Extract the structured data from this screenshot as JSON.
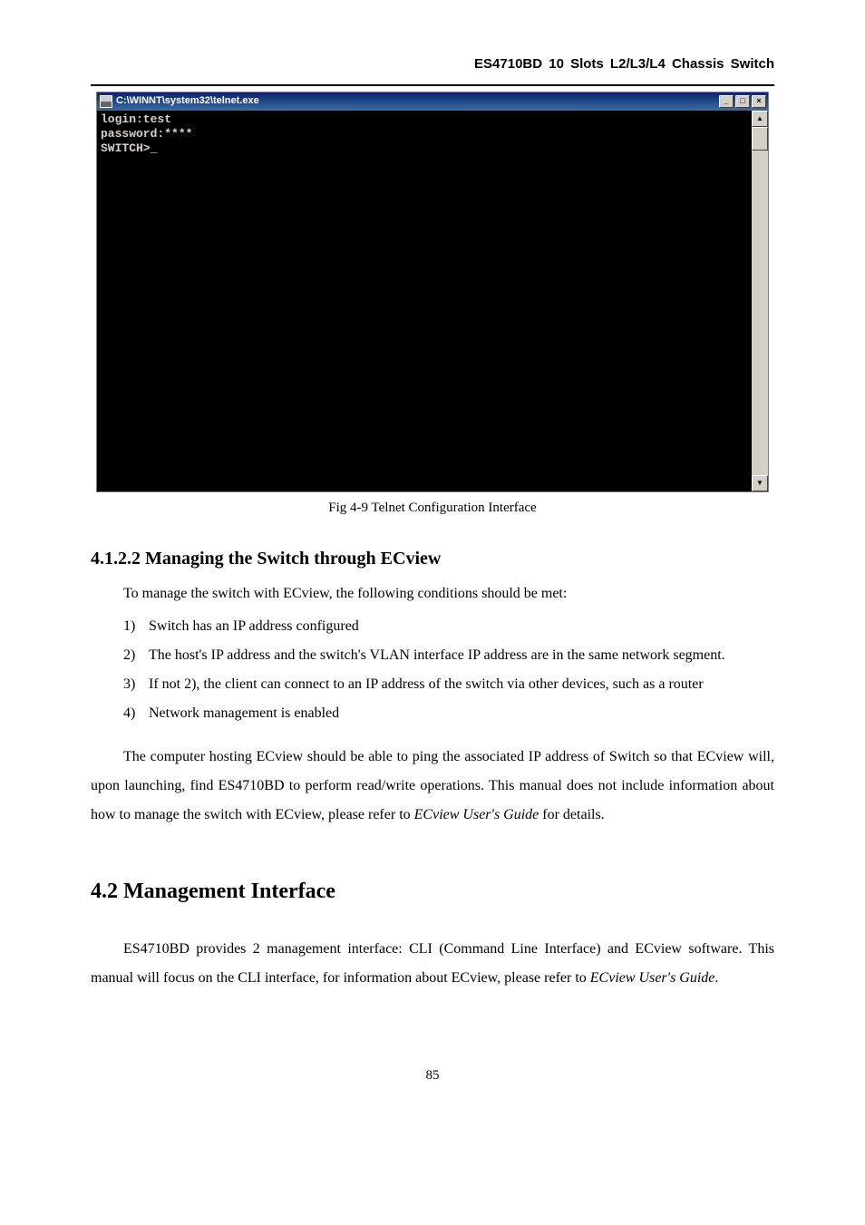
{
  "header": "ES4710BD 10 Slots L2/L3/L4 Chassis Switch",
  "terminal": {
    "title": "C:\\WINNT\\system32\\telnet.exe",
    "line1": "login:test",
    "line2": "password:****",
    "line3": "SWITCH>_",
    "min_glyph": "_",
    "max_glyph": "□",
    "close_glyph": "×",
    "up_glyph": "▲",
    "down_glyph": "▼"
  },
  "caption": "Fig 4-9    Telnet Configuration Interface",
  "section_4_1_2_2": {
    "title": "4.1.2.2    Managing the Switch through ECview",
    "intro": "To manage the switch with ECview, the following conditions should be met:",
    "items": [
      {
        "n": "1)",
        "t": "Switch has an IP address configured"
      },
      {
        "n": "2)",
        "t": "The host's IP address and the switch's VLAN interface IP address are in the same network segment."
      },
      {
        "n": "3)",
        "t": "If not 2), the client can connect to an IP address of the switch via other devices, such as a router"
      },
      {
        "n": "4)",
        "t": "Network management is enabled"
      }
    ],
    "para_pre": "The computer hosting ECview should be able to ping the associated IP address of Switch so that ECview will, upon launching, find ES4710BD to perform read/write operations. This manual does not include information about how to manage the switch with ECview, please refer to ",
    "para_em": "ECview User's Guide",
    "para_post": " for details."
  },
  "section_4_2": {
    "title": "4.2    Management Interface",
    "para_pre": "ES4710BD provides 2 management interface: CLI (Command Line Interface) and ECview software. This manual will focus on the CLI interface, for information about ECview, please refer to ",
    "para_em": "ECview User's Guide",
    "para_post": "."
  },
  "page_number": "85"
}
